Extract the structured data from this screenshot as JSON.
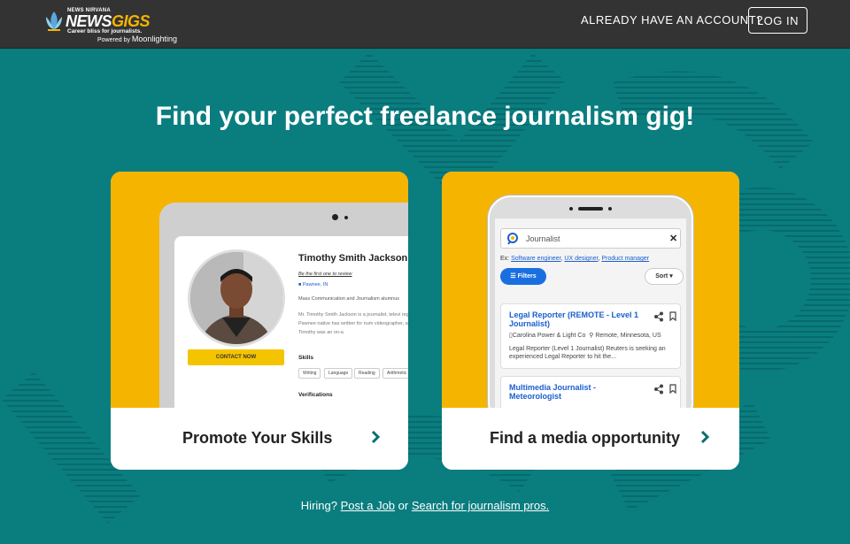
{
  "header": {
    "logo_small": "NEWS NIRVANA",
    "logo_brand_part1": "NEWS",
    "logo_brand_part2": "GIGS",
    "logo_tagline": "Career bliss for journalists.",
    "powered_prefix": "Powered by",
    "powered_brand": "Moonlighting",
    "account_prompt": "ALREADY HAVE AN ACCOUNT?",
    "login_label": "LOG IN"
  },
  "headline": "Find your perfect freelance journalism gig!",
  "cards": [
    {
      "label": "Promote Your Skills",
      "profile": {
        "name": "Timothy Smith Jackson",
        "review_link": "Be the first one to review",
        "location": "Pawnee, IN",
        "major": "Mass Communication and Journalism alumnus",
        "bio": "Mr. Timothy Smith Jackson is a journalist, televi region. The Pawnee native has written for num videographer, and editor. Timothy was an on-a",
        "contact_label": "CONTACT NOW",
        "skills_heading": "Skills",
        "skills": [
          "Writing",
          "Language",
          "Reading",
          "Arithmetic"
        ],
        "verifications_heading": "Verifications"
      }
    },
    {
      "label": "Find a media opportunity",
      "search": {
        "query": "Journalist",
        "examples_prefix": "Ex:",
        "examples": [
          "Software engineer",
          "UX designer",
          "Product manager"
        ],
        "filters_label": "Filters",
        "sort_label": "Sort"
      },
      "jobs": [
        {
          "title": "Legal Reporter (REMOTE - Level 1 Journalist)",
          "company": "Carolina Power & Light Co",
          "location": "Remote, Minnesota, US",
          "description": "Legal Reporter (Level 1 Journalist) Reuters is seeking an experienced Legal Reporter to hit the..."
        },
        {
          "title": "Multimedia Journalist - Meteorologist"
        }
      ]
    }
  ],
  "footer": {
    "hiring_prefix": "Hiring?",
    "post_job": "Post a Job",
    "or": "or",
    "search_pros": "Search for journalism pros."
  },
  "colors": {
    "background": "#0a7d7f",
    "topbar": "#333333",
    "card_accent": "#f5b400",
    "link_blue": "#1a5fd0"
  }
}
